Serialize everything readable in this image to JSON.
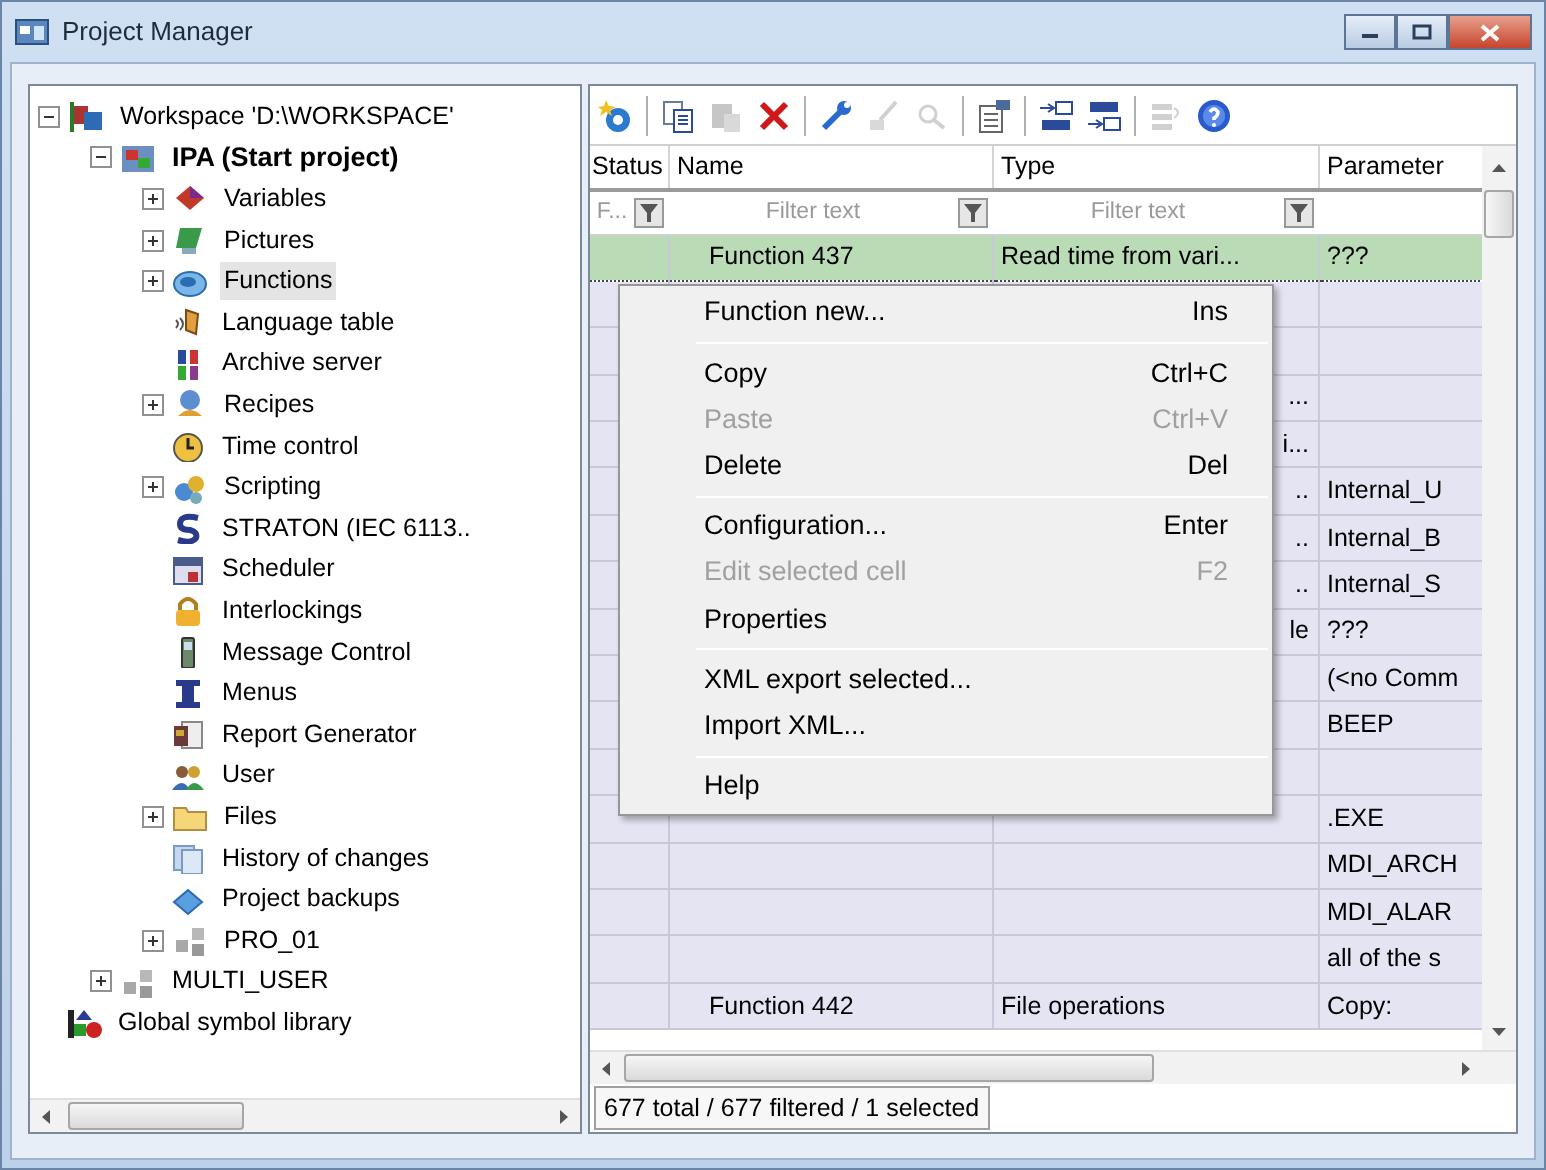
{
  "window": {
    "title": "Project Manager"
  },
  "tree": [
    {
      "label": "Workspace 'D:\\WORKSPACE'",
      "bold": false,
      "selected": false,
      "expandable": true,
      "expanded": true,
      "children": [
        {
          "label": "IPA (Start project)",
          "bold": true,
          "selected": false,
          "expandable": true,
          "expanded": true,
          "children": [
            {
              "label": "Variables",
              "bold": false,
              "selected": false,
              "expandable": true,
              "expanded": false
            },
            {
              "label": "Pictures",
              "bold": false,
              "selected": false,
              "expandable": true,
              "expanded": false
            },
            {
              "label": "Functions",
              "bold": false,
              "selected": true,
              "expandable": true,
              "expanded": false
            },
            {
              "label": "Language table",
              "bold": false,
              "selected": false,
              "expandable": false
            },
            {
              "label": "Archive server",
              "bold": false,
              "selected": false,
              "expandable": false
            },
            {
              "label": "Recipes",
              "bold": false,
              "selected": false,
              "expandable": true,
              "expanded": false
            },
            {
              "label": "Time control",
              "bold": false,
              "selected": false,
              "expandable": false
            },
            {
              "label": "Scripting",
              "bold": false,
              "selected": false,
              "expandable": true,
              "expanded": false
            },
            {
              "label": "STRATON (IEC 6113..",
              "bold": false,
              "selected": false,
              "expandable": false
            },
            {
              "label": "Scheduler",
              "bold": false,
              "selected": false,
              "expandable": false
            },
            {
              "label": "Interlockings",
              "bold": false,
              "selected": false,
              "expandable": false
            },
            {
              "label": "Message Control",
              "bold": false,
              "selected": false,
              "expandable": false
            },
            {
              "label": "Menus",
              "bold": false,
              "selected": false,
              "expandable": false
            },
            {
              "label": "Report Generator",
              "bold": false,
              "selected": false,
              "expandable": false
            },
            {
              "label": "User",
              "bold": false,
              "selected": false,
              "expandable": false
            },
            {
              "label": "Files",
              "bold": false,
              "selected": false,
              "expandable": true,
              "expanded": false
            },
            {
              "label": "History of changes",
              "bold": false,
              "selected": false,
              "expandable": false
            },
            {
              "label": "Project backups",
              "bold": false,
              "selected": false,
              "expandable": false
            },
            {
              "label": "PRO_01",
              "bold": false,
              "selected": false,
              "expandable": true,
              "expanded": false
            }
          ]
        },
        {
          "label": "MULTI_USER",
          "bold": false,
          "selected": false,
          "expandable": true,
          "expanded": false
        }
      ]
    },
    {
      "label": "Global symbol library",
      "bold": false,
      "selected": false,
      "expandable": false
    }
  ],
  "toolbar": [
    {
      "kind": "tool",
      "disabled": false
    },
    {
      "kind": "sep"
    },
    {
      "kind": "tool",
      "disabled": false
    },
    {
      "kind": "tool",
      "disabled": true
    },
    {
      "kind": "tool",
      "disabled": false
    },
    {
      "kind": "sep"
    },
    {
      "kind": "tool",
      "disabled": false
    },
    {
      "kind": "tool",
      "disabled": true
    },
    {
      "kind": "tool",
      "disabled": true
    },
    {
      "kind": "sep"
    },
    {
      "kind": "tool",
      "disabled": false
    },
    {
      "kind": "sep"
    },
    {
      "kind": "tool",
      "disabled": false
    },
    {
      "kind": "tool",
      "disabled": false
    },
    {
      "kind": "sep"
    },
    {
      "kind": "tool",
      "disabled": true
    },
    {
      "kind": "tool",
      "disabled": false
    }
  ],
  "table": {
    "columns": [
      "Status",
      "Name",
      "Type",
      "Parameter"
    ],
    "filters": [
      {
        "placeholder": "F..."
      },
      {
        "placeholder": "Filter text"
      },
      {
        "placeholder": "Filter text"
      }
    ],
    "rows": [
      {
        "selected": true,
        "name": "Function  437",
        "type": "Read time from vari...",
        "parameter": "???"
      },
      {
        "selected": false,
        "name": "",
        "type": "",
        "parameter": ""
      },
      {
        "selected": false,
        "name": "",
        "type": "",
        "parameter": ""
      },
      {
        "selected": false,
        "name": "",
        "type": "...",
        "parameter": ""
      },
      {
        "selected": false,
        "name": "",
        "type": "i...",
        "parameter": ""
      },
      {
        "selected": false,
        "name": "",
        "type": "..",
        "parameter": "Internal_U"
      },
      {
        "selected": false,
        "name": "",
        "type": "..",
        "parameter": "Internal_B"
      },
      {
        "selected": false,
        "name": "",
        "type": "..",
        "parameter": "Internal_S"
      },
      {
        "selected": false,
        "name": "",
        "type": "le",
        "parameter": "???"
      },
      {
        "selected": false,
        "name": "",
        "type": "",
        "parameter": "(<no Comm"
      },
      {
        "selected": false,
        "name": "",
        "type": "",
        "parameter": "BEEP"
      },
      {
        "selected": false,
        "name": "",
        "type": "",
        "parameter": ""
      },
      {
        "selected": false,
        "name": "",
        "type": "",
        "parameter": ".EXE"
      },
      {
        "selected": false,
        "name": "",
        "type": "",
        "parameter": "MDI_ARCH"
      },
      {
        "selected": false,
        "name": "",
        "type": "",
        "parameter": "MDI_ALAR"
      },
      {
        "selected": false,
        "name": "",
        "type": "",
        "parameter": "all of the s"
      },
      {
        "selected": false,
        "name": "Function  442",
        "type": "File operations",
        "parameter": "Copy:"
      }
    ]
  },
  "context_menu": [
    {
      "kind": "item",
      "label": "Function new...",
      "shortcut": "Ins",
      "disabled": false
    },
    {
      "kind": "separator"
    },
    {
      "kind": "item",
      "label": "Copy",
      "shortcut": "Ctrl+C",
      "disabled": false
    },
    {
      "kind": "item",
      "label": "Paste",
      "shortcut": "Ctrl+V",
      "disabled": true
    },
    {
      "kind": "item",
      "label": "Delete",
      "shortcut": "Del",
      "disabled": false
    },
    {
      "kind": "separator"
    },
    {
      "kind": "item",
      "label": "Configuration...",
      "shortcut": "Enter",
      "disabled": false
    },
    {
      "kind": "item",
      "label": "Edit selected cell",
      "shortcut": "F2",
      "disabled": true
    },
    {
      "kind": "item",
      "label": "Properties",
      "disabled": false
    },
    {
      "kind": "separator"
    },
    {
      "kind": "item",
      "label": "XML export selected...",
      "disabled": false
    },
    {
      "kind": "item",
      "label": "Import XML...",
      "disabled": false
    },
    {
      "kind": "separator"
    },
    {
      "kind": "item",
      "label": "Help",
      "disabled": false
    }
  ],
  "status_bar": "677 total / 677 filtered / 1 selected"
}
